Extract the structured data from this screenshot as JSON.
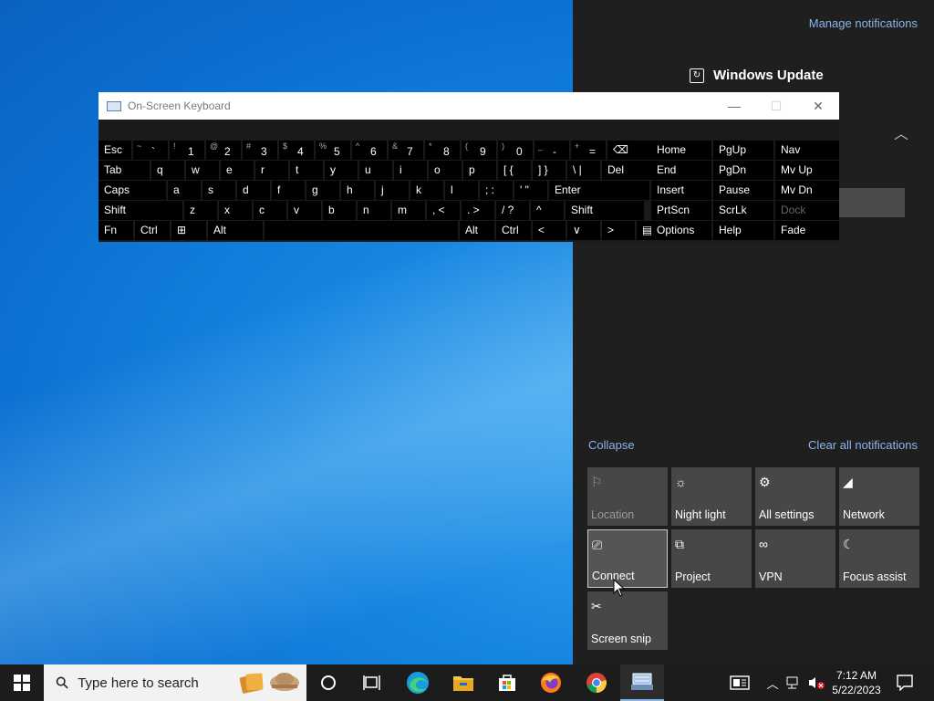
{
  "action_center": {
    "manage_notifications": "Manage notifications",
    "windows_update_title": "Windows Update",
    "collapse": "Collapse",
    "clear_all": "Clear all notifications",
    "tiles": [
      {
        "label": "Location",
        "icon": "location-icon",
        "disabled": true
      },
      {
        "label": "Night light",
        "icon": "night-light-icon"
      },
      {
        "label": "All settings",
        "icon": "gear-icon"
      },
      {
        "label": "Network",
        "icon": "network-icon"
      },
      {
        "label": "Connect",
        "icon": "connect-icon",
        "selected": true
      },
      {
        "label": "Project",
        "icon": "project-icon"
      },
      {
        "label": "VPN",
        "icon": "vpn-icon"
      },
      {
        "label": "Focus assist",
        "icon": "moon-icon"
      },
      {
        "label": "Screen snip",
        "icon": "screen-snip-icon"
      }
    ]
  },
  "osk": {
    "title": "On-Screen Keyboard",
    "row1": [
      {
        "label": "Esc"
      },
      {
        "shift": "~",
        "main": "`"
      },
      {
        "shift": "!",
        "main": "1"
      },
      {
        "shift": "@",
        "main": "2"
      },
      {
        "shift": "#",
        "main": "3"
      },
      {
        "shift": "$",
        "main": "4"
      },
      {
        "shift": "%",
        "main": "5"
      },
      {
        "shift": "^",
        "main": "6"
      },
      {
        "shift": "&",
        "main": "7"
      },
      {
        "shift": "*",
        "main": "8"
      },
      {
        "shift": "(",
        "main": "9"
      },
      {
        "shift": ")",
        "main": "0"
      },
      {
        "shift": "_",
        "main": "-"
      },
      {
        "shift": "+",
        "main": "="
      },
      {
        "label": "⌫"
      }
    ],
    "row2": [
      "Tab",
      "q",
      "w",
      "e",
      "r",
      "t",
      "y",
      "u",
      "i",
      "o",
      "p",
      "[ {",
      "] }",
      "\\ |",
      "Del"
    ],
    "row3": [
      "Caps",
      "a",
      "s",
      "d",
      "f",
      "g",
      "h",
      "j",
      "k",
      "l",
      "; :",
      "' \"",
      "Enter"
    ],
    "row4": [
      "Shift",
      "z",
      "x",
      "c",
      "v",
      "b",
      "n",
      "m",
      ", <",
      ". >",
      "/ ?",
      "^",
      "Shift"
    ],
    "row5": [
      "Fn",
      "Ctrl",
      "⊞",
      "Alt",
      "",
      "Alt",
      "Ctrl",
      "<",
      "∨",
      ">",
      "▤"
    ],
    "nav": [
      [
        "Home",
        "PgUp",
        "Nav"
      ],
      [
        "End",
        "PgDn",
        "Mv Up"
      ],
      [
        "Insert",
        "Pause",
        "Mv Dn"
      ],
      [
        "PrtScn",
        "ScrLk",
        "Dock"
      ],
      [
        "Options",
        "Help",
        "Fade"
      ]
    ]
  },
  "taskbar": {
    "search_placeholder": "Type here to search",
    "time": "7:12 AM",
    "date": "5/22/2023"
  }
}
